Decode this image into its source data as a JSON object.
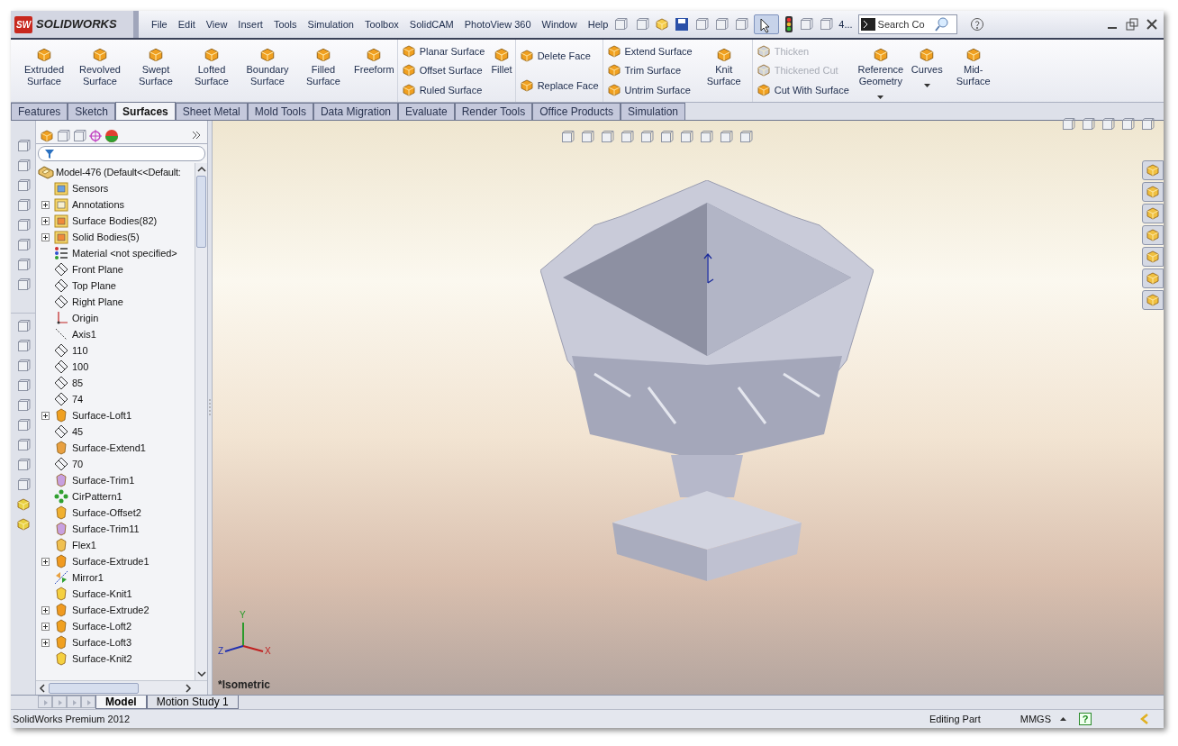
{
  "logo": {
    "badge": "SW",
    "text": "SOLIDWORKS"
  },
  "menu": [
    "File",
    "Edit",
    "View",
    "Insert",
    "Tools",
    "Simulation",
    "Toolbox",
    "SolidCAM",
    "PhotoView 360",
    "Window",
    "Help"
  ],
  "toolbar": {
    "overflow_label": "4...",
    "search": {
      "placeholder": "Search Co"
    }
  },
  "ribbon": [
    {
      "kind": "large",
      "label": "Extruded Surface",
      "dropdown": false
    },
    {
      "kind": "large",
      "label": "Revolved Surface",
      "dropdown": false
    },
    {
      "kind": "large",
      "label": "Swept Surface",
      "dropdown": false
    },
    {
      "kind": "large",
      "label": "Lofted Surface",
      "dropdown": false
    },
    {
      "kind": "large",
      "label": "Boundary Surface",
      "dropdown": false
    },
    {
      "kind": "large",
      "label": "Filled Surface",
      "dropdown": false
    },
    {
      "kind": "large",
      "label": "Freeform",
      "dropdown": false
    },
    {
      "kind": "stack",
      "items": [
        {
          "label": "Planar Surface",
          "disabled": false
        },
        {
          "label": "Offset Surface",
          "disabled": false
        },
        {
          "label": "Ruled Surface",
          "disabled": false
        }
      ]
    },
    {
      "kind": "large",
      "label": "Fillet",
      "dropdown": false
    },
    {
      "kind": "stack",
      "items": [
        {
          "label": "Delete Face",
          "disabled": false
        },
        {
          "label": "Replace Face",
          "disabled": false
        }
      ]
    },
    {
      "kind": "stack",
      "items": [
        {
          "label": "Extend Surface",
          "disabled": false
        },
        {
          "label": "Trim Surface",
          "disabled": false
        },
        {
          "label": "Untrim Surface",
          "disabled": false
        }
      ]
    },
    {
      "kind": "large",
      "label": "Knit Surface",
      "dropdown": false
    },
    {
      "kind": "stack",
      "items": [
        {
          "label": "Thicken",
          "disabled": true
        },
        {
          "label": "Thickened Cut",
          "disabled": true
        },
        {
          "label": "Cut With Surface",
          "disabled": false
        }
      ]
    },
    {
      "kind": "large",
      "label": "Reference Geometry",
      "dropdown": true
    },
    {
      "kind": "large",
      "label": "Curves",
      "dropdown": true
    },
    {
      "kind": "large",
      "label": "Mid-Surface",
      "dropdown": false
    }
  ],
  "tabs": [
    {
      "label": "Features",
      "selected": false
    },
    {
      "label": "Sketch",
      "selected": false
    },
    {
      "label": "Surfaces",
      "selected": true
    },
    {
      "label": "Sheet Metal",
      "selected": false
    },
    {
      "label": "Mold Tools",
      "selected": false
    },
    {
      "label": "Data Migration",
      "selected": false
    },
    {
      "label": "Evaluate",
      "selected": false
    },
    {
      "label": "Render Tools",
      "selected": false
    },
    {
      "label": "Office Products",
      "selected": false
    },
    {
      "label": "Simulation",
      "selected": false
    }
  ],
  "feature_tree": {
    "root": {
      "label": "Model-476 (Default<<Default:",
      "kind": "part"
    },
    "children": [
      {
        "label": "Sensors",
        "kind": "sensor",
        "collapsed": false
      },
      {
        "label": "Annotations",
        "kind": "annotation",
        "collapsed": true
      },
      {
        "label": "Surface Bodies(82)",
        "kind": "folder",
        "collapsed": true
      },
      {
        "label": "Solid Bodies(5)",
        "kind": "folder",
        "collapsed": true
      },
      {
        "label": "Material <not specified>",
        "kind": "material",
        "collapsed": false
      },
      {
        "label": "Front Plane",
        "kind": "plane",
        "collapsed": false
      },
      {
        "label": "Top Plane",
        "kind": "plane",
        "collapsed": false
      },
      {
        "label": "Right Plane",
        "kind": "plane",
        "collapsed": false
      },
      {
        "label": "Origin",
        "kind": "origin",
        "collapsed": false
      },
      {
        "label": "Axis1",
        "kind": "axis",
        "collapsed": false
      },
      {
        "label": "110",
        "kind": "plane",
        "collapsed": false
      },
      {
        "label": "100",
        "kind": "plane",
        "collapsed": false
      },
      {
        "label": "85",
        "kind": "plane",
        "collapsed": false
      },
      {
        "label": "74",
        "kind": "plane",
        "collapsed": false
      },
      {
        "label": "Surface-Loft1",
        "kind": "loft",
        "collapsed": true
      },
      {
        "label": "45",
        "kind": "plane",
        "collapsed": false
      },
      {
        "label": "Surface-Extend1",
        "kind": "extend",
        "collapsed": false
      },
      {
        "label": "70",
        "kind": "plane",
        "collapsed": false
      },
      {
        "label": "Surface-Trim1",
        "kind": "trim",
        "collapsed": false
      },
      {
        "label": "CirPattern1",
        "kind": "pattern",
        "collapsed": false
      },
      {
        "label": "Surface-Offset2",
        "kind": "offset",
        "collapsed": false
      },
      {
        "label": "Surface-Trim11",
        "kind": "trim",
        "collapsed": false
      },
      {
        "label": "Flex1",
        "kind": "flex",
        "collapsed": false
      },
      {
        "label": "Surface-Extrude1",
        "kind": "extrude",
        "collapsed": true
      },
      {
        "label": "Mirror1",
        "kind": "mirror",
        "collapsed": false
      },
      {
        "label": "Surface-Knit1",
        "kind": "knit",
        "collapsed": false
      },
      {
        "label": "Surface-Extrude2",
        "kind": "extrude",
        "collapsed": true
      },
      {
        "label": "Surface-Loft2",
        "kind": "loft",
        "collapsed": true
      },
      {
        "label": "Surface-Loft3",
        "kind": "loft",
        "collapsed": true
      },
      {
        "label": "Surface-Knit2",
        "kind": "knit",
        "collapsed": false
      }
    ]
  },
  "viewport": {
    "view_name": "*Isometric",
    "triad": {
      "x": "X",
      "y": "Y",
      "z": "Z"
    }
  },
  "bottom_tabs": [
    {
      "label": "Model",
      "selected": true
    },
    {
      "label": "Motion Study 1",
      "selected": false
    }
  ],
  "status_bar": {
    "product": "SolidWorks Premium 2012",
    "mode": "Editing Part",
    "units": "MMGS",
    "help": "?"
  }
}
